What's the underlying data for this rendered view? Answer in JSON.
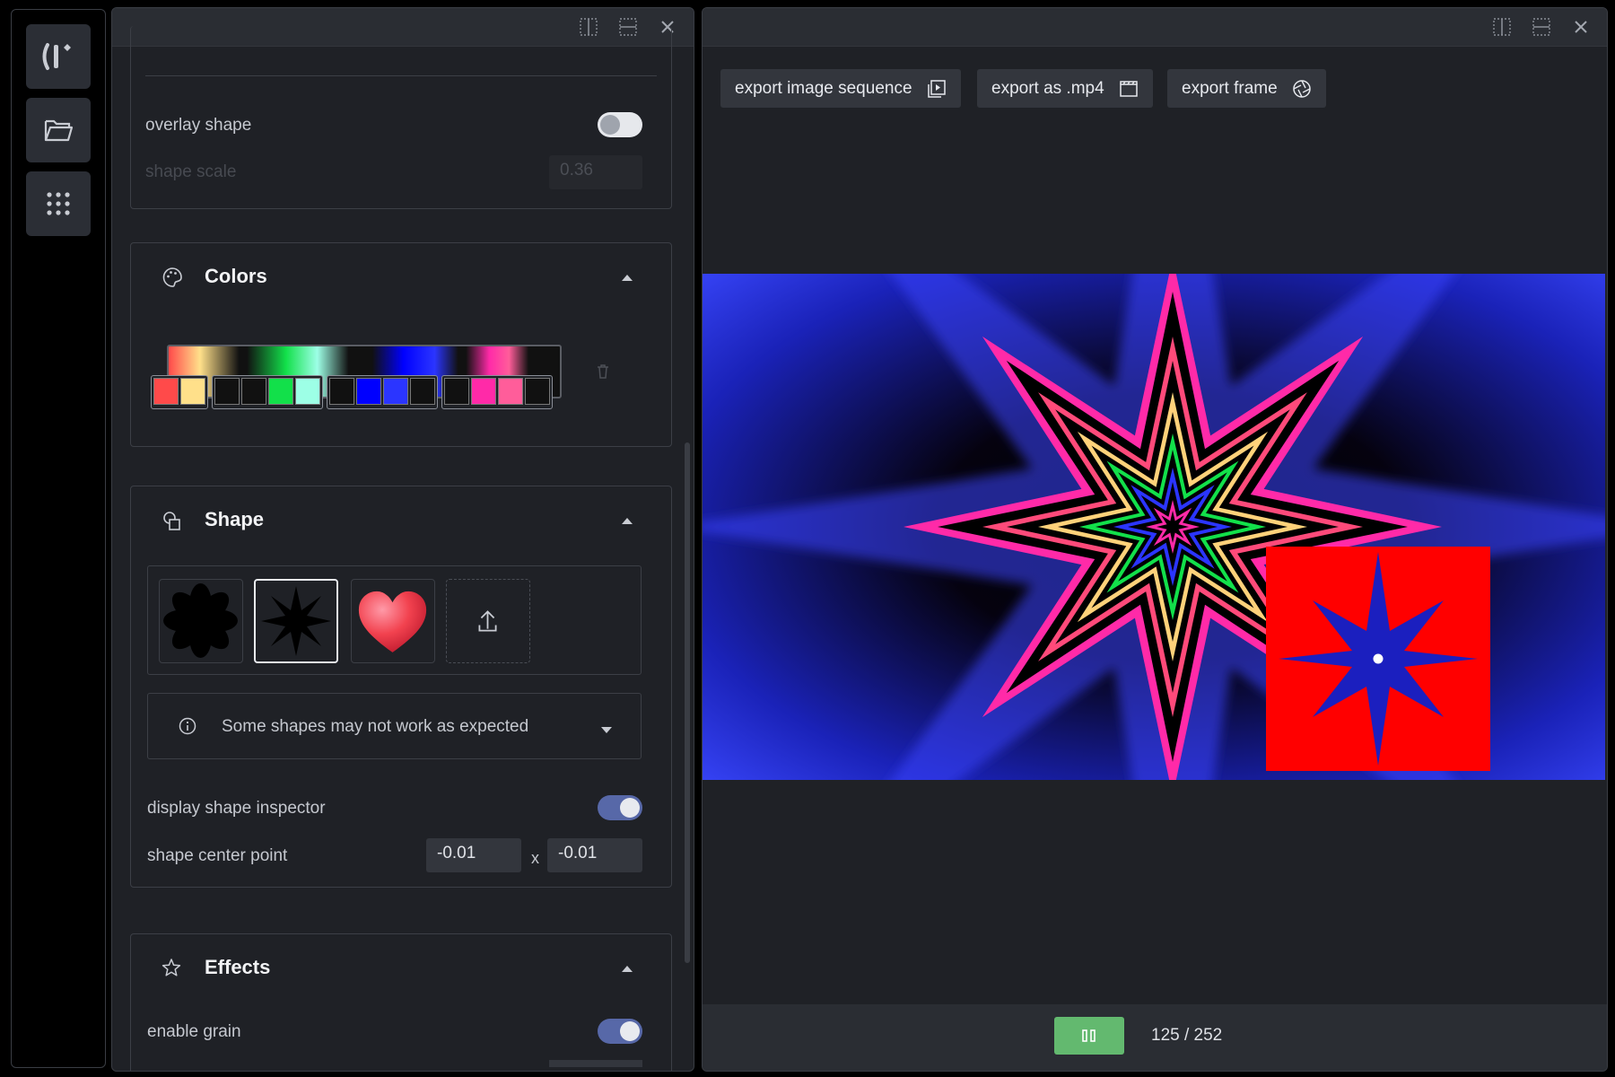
{
  "rail": {
    "items": [
      "logo-icon",
      "folder-icon",
      "grid-icon"
    ]
  },
  "settings": {
    "overlay_shape_label": "overlay shape",
    "overlay_shape_on": false,
    "shape_scale_label": "shape scale",
    "shape_scale_value": "0.36",
    "colors": {
      "title": "Colors",
      "stop_colors": [
        "#ff4a4a",
        "#ffe08a",
        "#111111",
        "#111111",
        "#12e04a",
        "#9dffe6",
        "#111111",
        "#0000ff",
        "#2b35ff",
        "#111111",
        "#111111",
        "#ff2aa8",
        "#ff5d9a",
        "#111111"
      ]
    },
    "shape": {
      "title": "Shape",
      "tiles": [
        "flower-shape-icon",
        "star-shape-icon",
        "heart-shape-icon",
        "upload-icon"
      ],
      "selected": 1,
      "warning": "Some shapes may not work as expected",
      "display_inspector_label": "display shape inspector",
      "display_inspector_on": true,
      "center_label": "shape center point",
      "center_x": "-0.01",
      "center_sep": "x",
      "center_y": "-0.01"
    },
    "effects": {
      "title": "Effects",
      "grain_label": "enable grain",
      "grain_on": true
    }
  },
  "preview": {
    "export_sequence": "export image sequence",
    "export_mp4": "export as .mp4",
    "export_frame": "export frame",
    "frame_counter": "125 / 252",
    "colors": {
      "accent_green": "#63b96f",
      "toggle_on": "#5768a8"
    }
  }
}
